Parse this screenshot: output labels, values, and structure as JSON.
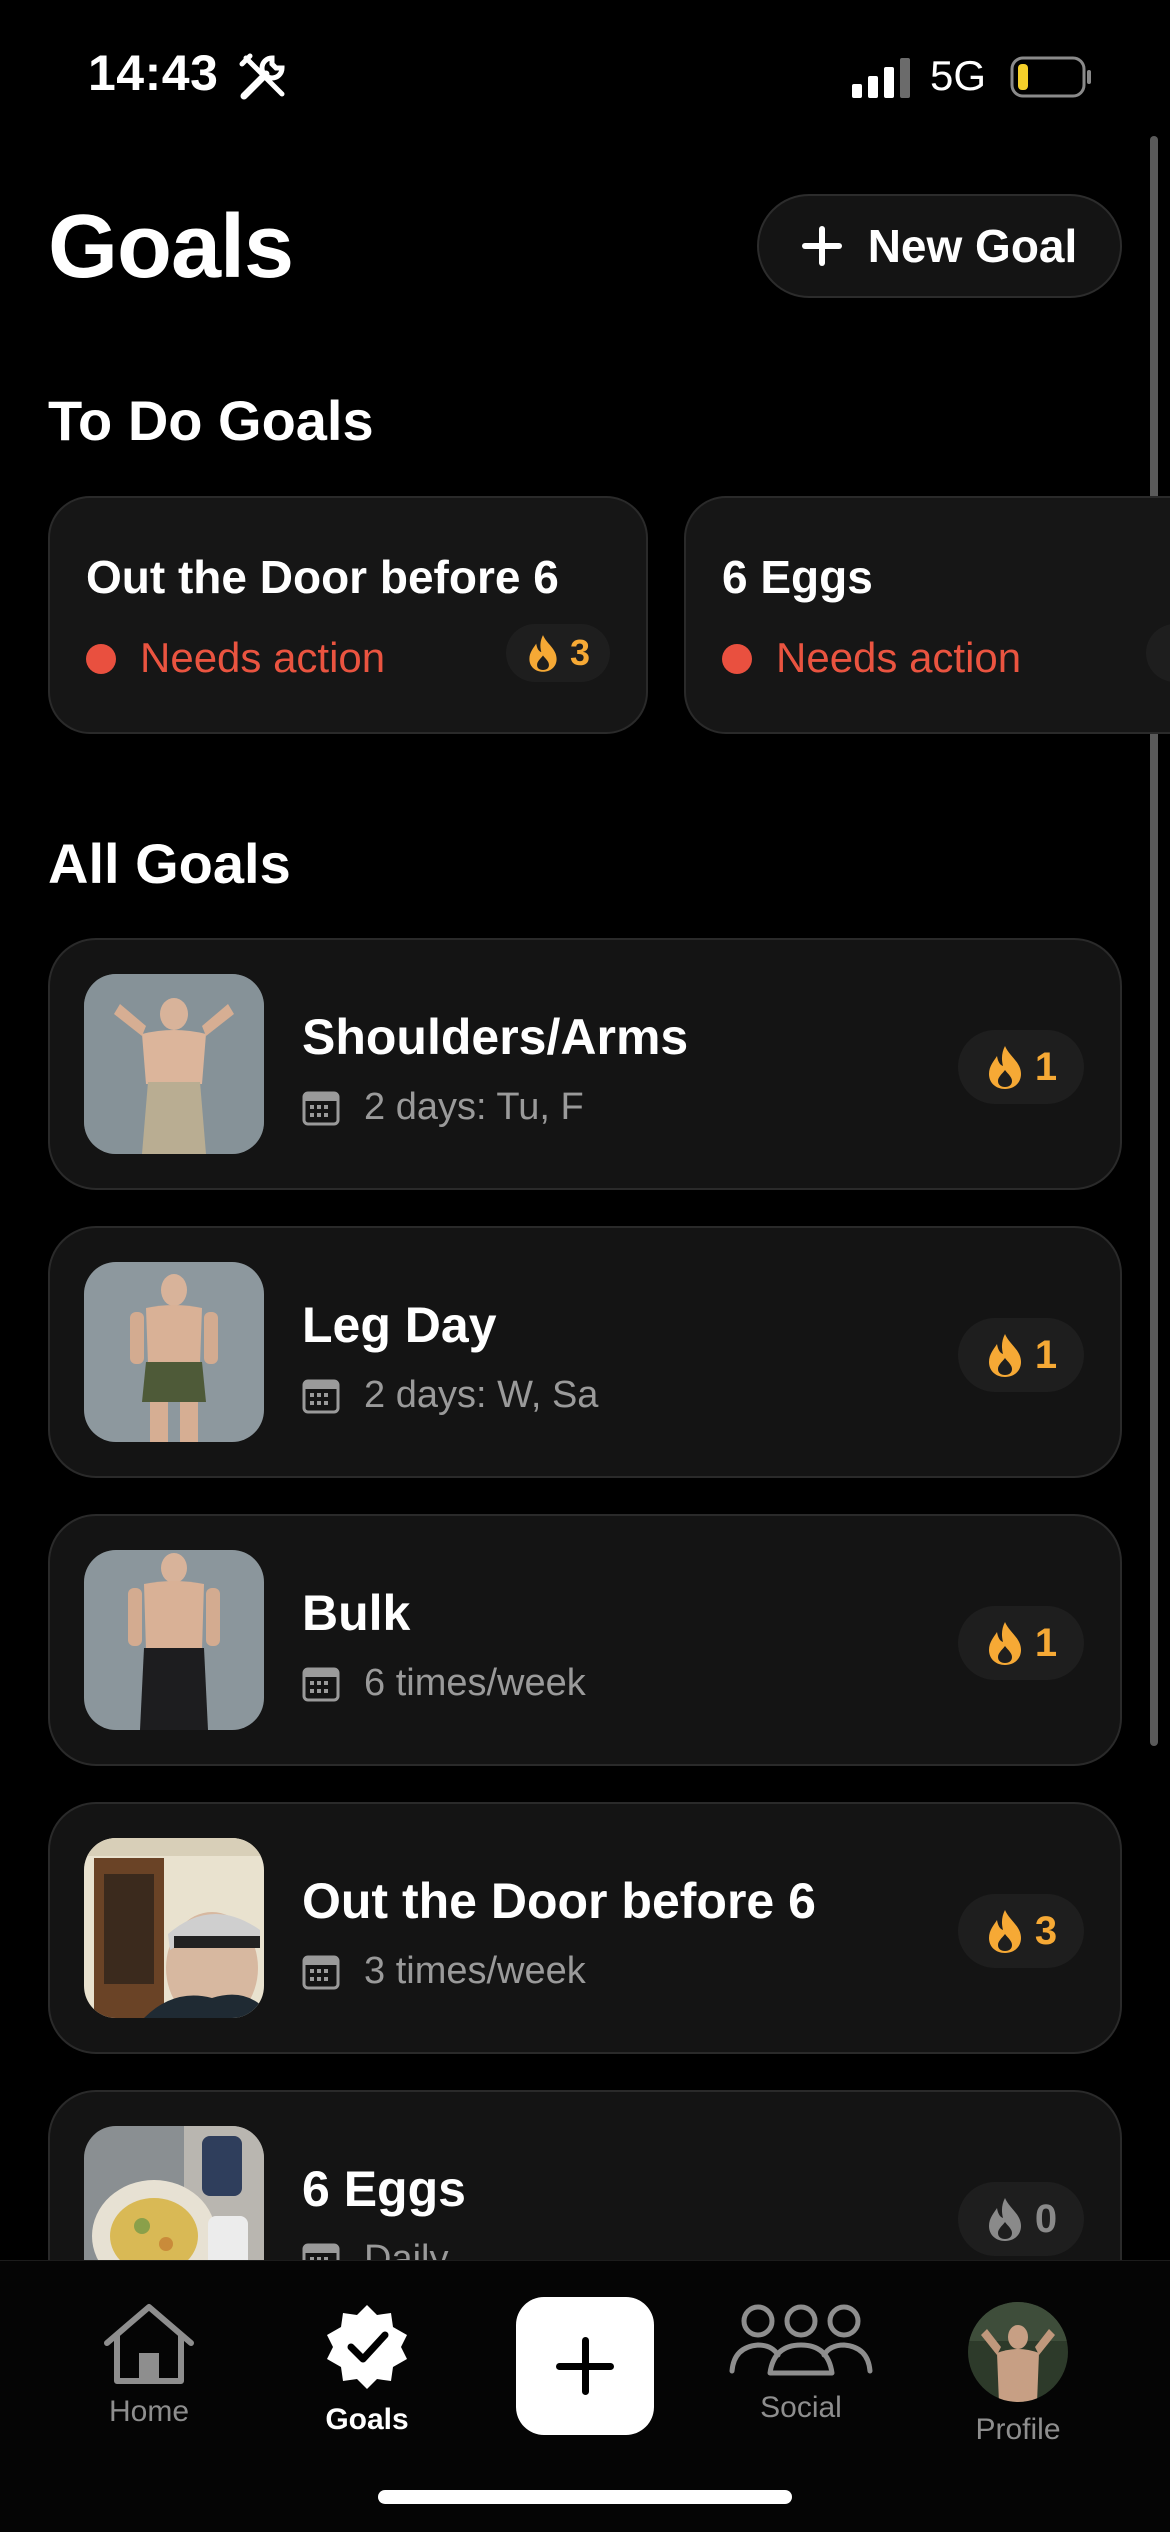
{
  "status_bar": {
    "time": "14:43",
    "network": "5G",
    "battery_color": "#f5d02a"
  },
  "header": {
    "title": "Goals",
    "new_goal_label": "New Goal"
  },
  "todo_section": {
    "title": "To Do Goals",
    "cards": [
      {
        "title": "Out the Door before 6",
        "status": "Needs action",
        "streak": "3"
      },
      {
        "title": "6 Eggs",
        "status": "Needs action",
        "streak": ""
      }
    ]
  },
  "all_section": {
    "title": "All Goals",
    "goals": [
      {
        "name": "Shoulders/Arms",
        "schedule": "2 days: Tu, F",
        "streak": "1"
      },
      {
        "name": "Leg Day",
        "schedule": "2 days: W, Sa",
        "streak": "1"
      },
      {
        "name": "Bulk",
        "schedule": "6 times/week",
        "streak": "1"
      },
      {
        "name": "Out the Door before 6",
        "schedule": "3 times/week",
        "streak": "3"
      },
      {
        "name": "6 Eggs",
        "schedule": "Daily",
        "streak": "0"
      }
    ]
  },
  "tab_bar": {
    "home": "Home",
    "goals": "Goals",
    "social": "Social",
    "profile": "Profile"
  },
  "colors": {
    "accent_streak": "#f6a935",
    "needs_action": "#ea5440",
    "background": "#000000"
  }
}
